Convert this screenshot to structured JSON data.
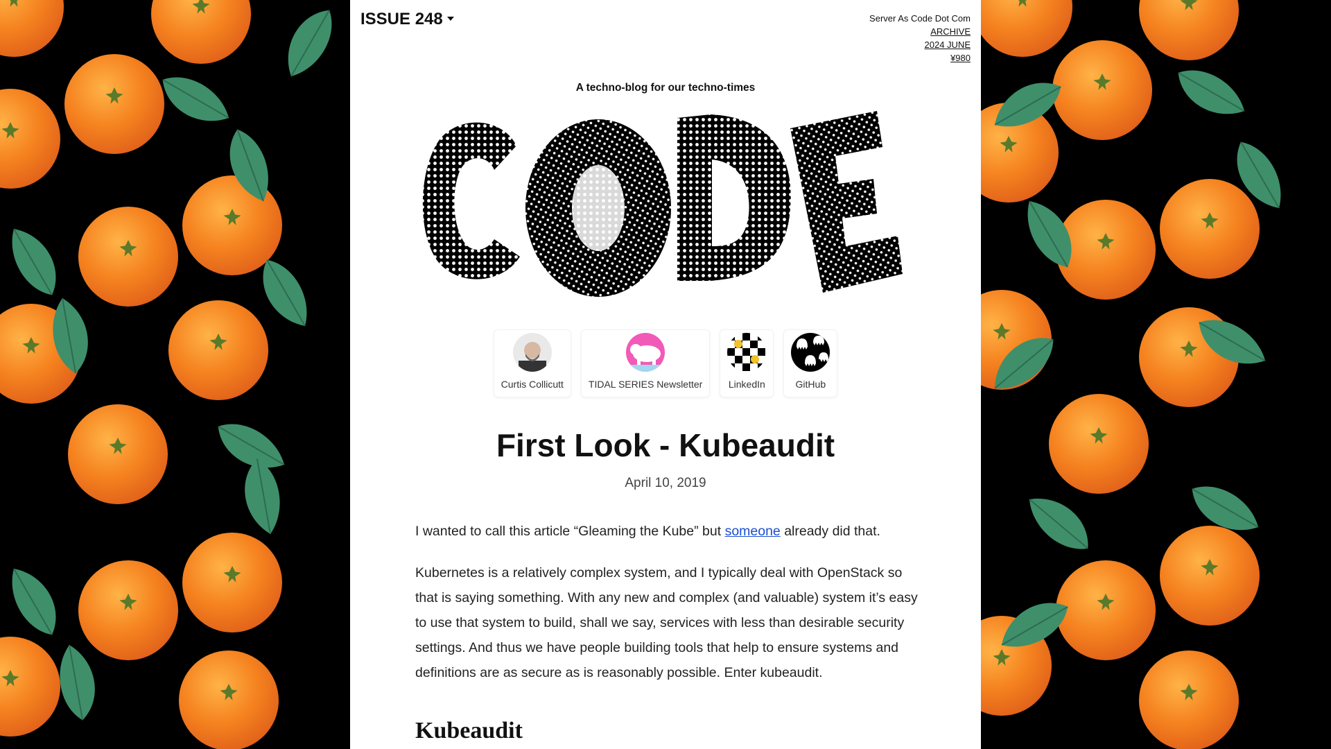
{
  "header": {
    "issue_label": "ISSUE 248",
    "site_name": "Server As Code Dot Com",
    "archive_link": "ARCHIVE",
    "edition_link": "2024 JUNE",
    "price_link": "¥980"
  },
  "masthead": {
    "tagline": "A techno-blog for our techno-times",
    "logo_text": "CODE"
  },
  "links": [
    {
      "label": "Curtis Collicutt",
      "icon": "profile-photo-icon"
    },
    {
      "label": "TIDAL SERIES Newsletter",
      "icon": "polar-bear-icon"
    },
    {
      "label": "LinkedIn",
      "icon": "checkered-smiley-icon"
    },
    {
      "label": "GitHub",
      "icon": "ghost-pattern-icon"
    }
  ],
  "article": {
    "title": "First Look - Kubeaudit",
    "date": "April 10, 2019",
    "p1_before": "I wanted to call this article “Gleaming the Kube” but ",
    "p1_link": "someone",
    "p1_after": " already did that.",
    "p2": "Kubernetes is a relatively complex system, and I typically deal with OpenStack so that is saying something. With any new and complex (and valuable) system it’s easy to use that system to build, shall we say, services with less than desirable security settings. And thus we have people building tools that help to ensure systems and definitions are as secure as is reasonably possible. Enter kubeaudit.",
    "h2": "Kubeaudit"
  },
  "colors": {
    "background": "#000000",
    "orange": "#f58a1f",
    "leaf": "#3f8f6b",
    "link": "#1a4fd0"
  }
}
